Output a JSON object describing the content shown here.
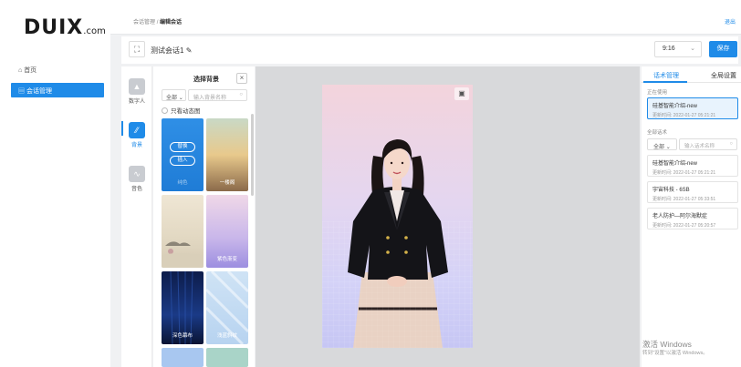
{
  "sidebar": {
    "logo_main": "DUIX",
    "logo_suffix": ".com",
    "items": [
      {
        "label": "首页"
      },
      {
        "label": "会话管理"
      }
    ]
  },
  "header": {
    "breadcrumb_parent": "会话管理",
    "breadcrumb_sep": "/",
    "breadcrumb_current": "编辑会话",
    "logout": "退出"
  },
  "titlebar": {
    "title": "测试会话1",
    "ratio": "9:16",
    "save_label": "保存"
  },
  "rail": {
    "items": [
      {
        "label": "数字人"
      },
      {
        "label": "背景"
      },
      {
        "label": "音色"
      }
    ]
  },
  "bg_panel": {
    "title": "选择背景",
    "filter_select": "全部",
    "search_placeholder": "输入背景名称",
    "checkbox_label": "只看动态图",
    "thumb_buttons": {
      "replace": "替换",
      "insert": "插入"
    },
    "thumbs": [
      {
        "label": "纯色"
      },
      {
        "label": "一楼阁"
      },
      {
        "label": ""
      },
      {
        "label": "紫色渐变"
      },
      {
        "label": "深色幕布"
      },
      {
        "label": "浅蓝斜纹"
      }
    ]
  },
  "right_panel": {
    "tabs": [
      {
        "label": "话术管理"
      },
      {
        "label": "全局设置"
      }
    ],
    "current_section": "正在使用",
    "all_section": "全部话术",
    "filter_select": "全部",
    "search_placeholder": "输入话术名称",
    "current_card": {
      "title": "硅基智能介绍-new",
      "time": "更新时间: 2022-01-27 05:21:21"
    },
    "cards": [
      {
        "title": "硅基智能介绍-new",
        "time": "更新时间: 2022-01-27 05:21:21"
      },
      {
        "title": "宇宙科技 - 6SB",
        "time": "更新时间: 2022-01-27 05:33:51"
      },
      {
        "title": "老人防护—阿尔海默症",
        "time": "更新时间: 2022-01-27 05:20:57"
      }
    ]
  },
  "watermark": {
    "line1": "激活 Windows",
    "line2": "转到\"设置\"以激活 Windows。"
  },
  "colors": {
    "accent": "#1f8be8"
  }
}
